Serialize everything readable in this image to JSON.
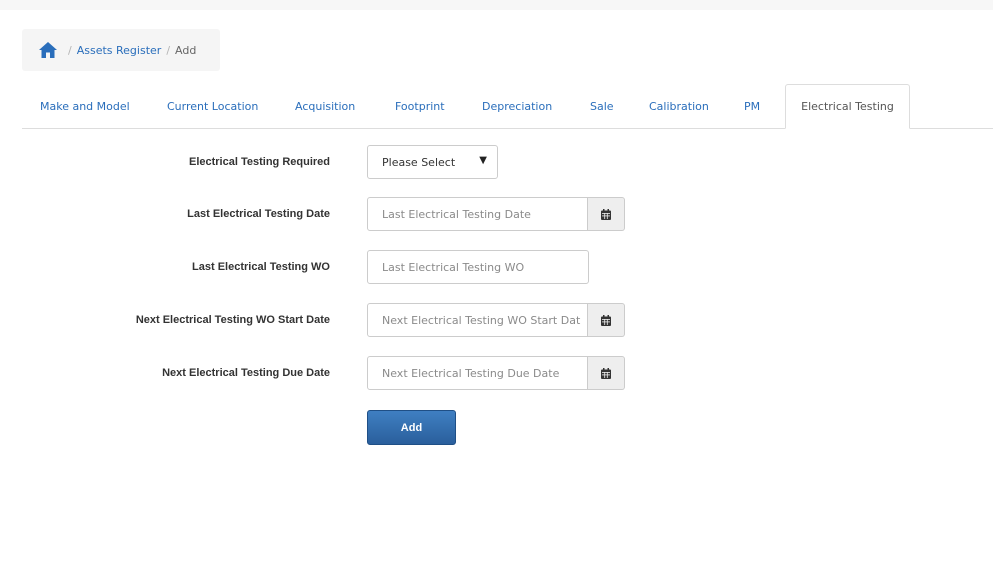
{
  "breadcrumb": {
    "home_icon": "home-icon",
    "items": [
      "Assets Register",
      "Add"
    ],
    "separator": "/"
  },
  "tabs": [
    {
      "label": "Make and Model",
      "active": false
    },
    {
      "label": "Current Location",
      "active": false
    },
    {
      "label": "Acquisition",
      "active": false
    },
    {
      "label": "Footprint",
      "active": false
    },
    {
      "label": "Depreciation",
      "active": false
    },
    {
      "label": "Sale",
      "active": false
    },
    {
      "label": "Calibration",
      "active": false
    },
    {
      "label": "PM",
      "active": false
    },
    {
      "label": "Electrical Testing",
      "active": true
    }
  ],
  "form": {
    "required": {
      "label": "Electrical Testing Required",
      "value": "Please Select",
      "caret": "▼"
    },
    "last_date": {
      "label": "Last Electrical Testing Date",
      "placeholder": "Last Electrical Testing Date",
      "icon": "calendar-icon"
    },
    "last_wo": {
      "label": "Last Electrical Testing WO",
      "placeholder": "Last Electrical Testing WO"
    },
    "next_wo_start": {
      "label": "Next Electrical Testing WO Start Date",
      "placeholder": "Next Electrical Testing WO Start Dat",
      "icon": "calendar-icon"
    },
    "next_due": {
      "label": "Next Electrical Testing Due Date",
      "placeholder": "Next Electrical Testing Due Date",
      "icon": "calendar-icon"
    },
    "submit_label": "Add"
  },
  "colors": {
    "link": "#2a6ebb",
    "button": "#2f68a8",
    "border": "#dddddd"
  }
}
